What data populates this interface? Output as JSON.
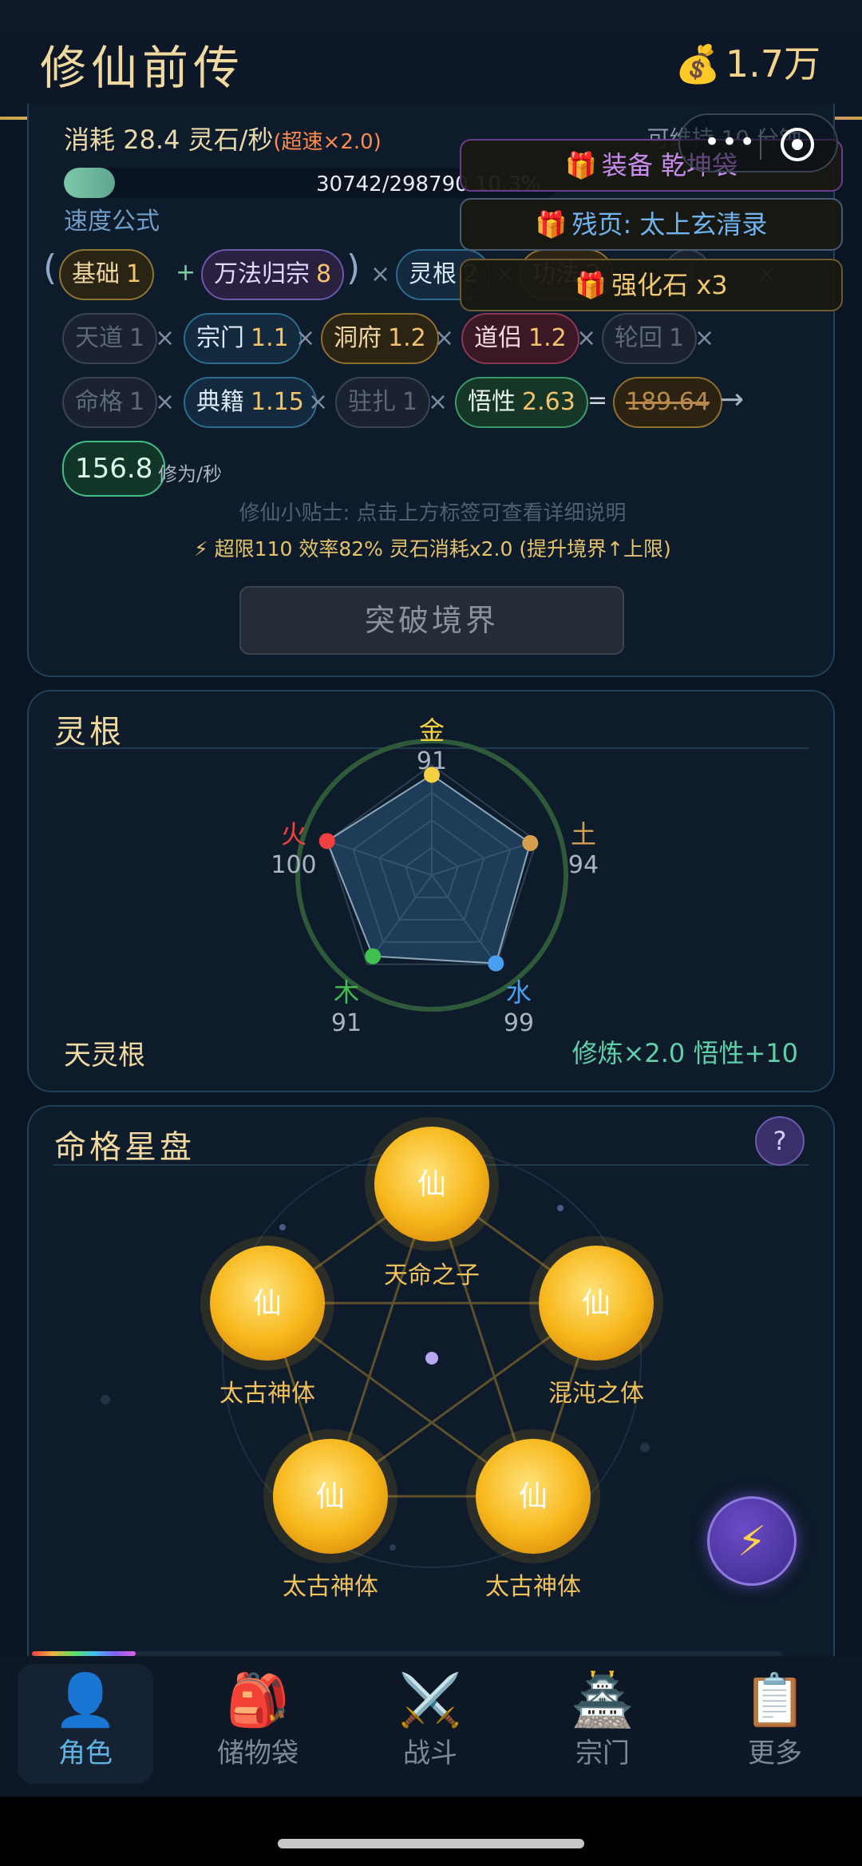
{
  "header": {
    "title": "修仙前传",
    "money_icon": "money-bag-icon",
    "money": "1.7万"
  },
  "speed": {
    "consume_prefix": "消耗",
    "consume_value": "28.4",
    "consume_unit": "灵石/秒",
    "boost": "(超速×2.0)",
    "sustain": "可维持 10 分钟",
    "progress_text": "30742/298790  10.3%",
    "progress_fraction": 0.103,
    "formula_label": "速度公式",
    "row1": {
      "open_paren": "(",
      "close_paren": ")",
      "plus": "+",
      "times": "×",
      "base": {
        "name": "基础",
        "value": "1"
      },
      "wanfa": {
        "name": "万法归宗",
        "value": "8"
      },
      "linggen": {
        "name": "灵根",
        "value": "2"
      },
      "gongfa": {
        "name": "功法",
        "value": "2"
      },
      "hidden": {
        "name": "",
        "value": "1"
      }
    },
    "row2": [
      {
        "name": "天道",
        "value": "1"
      },
      {
        "name": "宗门",
        "value": "1.1"
      },
      {
        "name": "洞府",
        "value": "1.2"
      },
      {
        "name": "道侣",
        "value": "1.2"
      },
      {
        "name": "轮回",
        "value": "1"
      }
    ],
    "row3": [
      {
        "name": "命格",
        "value": "1"
      },
      {
        "name": "典籍",
        "value": "1.15"
      },
      {
        "name": "驻扎",
        "value": "1"
      },
      {
        "name": "悟性",
        "value": "2.63"
      }
    ],
    "equals": "=",
    "struck": "189.64",
    "arrow": "→",
    "result": "156.8",
    "result_unit": "修为/秒",
    "tip": "修仙小贴士: 点击上方标签可查看详细说明",
    "limit": "⚡ 超限110 效率82% 灵石消耗x2.0 (提升境界↑上限)",
    "break_button": "突破境界"
  },
  "toasts": [
    {
      "text": "装备 乾坤袋",
      "icon": "gift-icon"
    },
    {
      "text": "残页: 太上玄清录",
      "icon": "gift-icon"
    },
    {
      "text": "强化石 x3",
      "icon": "gift-icon"
    }
  ],
  "root": {
    "title": "灵根",
    "elements": [
      {
        "name": "金",
        "value": "91",
        "color": "#f5d040"
      },
      {
        "name": "土",
        "value": "94",
        "color": "#d4a050"
      },
      {
        "name": "水",
        "value": "99",
        "color": "#4aa0f0"
      },
      {
        "name": "木",
        "value": "91",
        "color": "#40c050"
      },
      {
        "name": "火",
        "value": "100",
        "color": "#f04040"
      }
    ],
    "values_numeric": [
      91,
      94,
      99,
      91,
      100
    ],
    "type_name": "天灵根",
    "bonus": "修炼×2.0  悟性+10"
  },
  "star": {
    "title": "命格星盘",
    "help": "?",
    "orbs": [
      {
        "glyph": "仙",
        "label": "天命之子"
      },
      {
        "glyph": "仙",
        "label": "太古神体"
      },
      {
        "glyph": "仙",
        "label": "混沌之体"
      },
      {
        "glyph": "仙",
        "label": "太古神体"
      },
      {
        "glyph": "仙",
        "label": "太古神体"
      }
    ],
    "fab_icon": "⚡"
  },
  "nav": [
    {
      "label": "角色",
      "icon": "👤",
      "icon_name": "person-icon",
      "active": true
    },
    {
      "label": "储物袋",
      "icon": "🎒",
      "icon_name": "backpack-icon",
      "active": false
    },
    {
      "label": "战斗",
      "icon": "⚔️",
      "icon_name": "crossed-swords-icon",
      "active": false
    },
    {
      "label": "宗门",
      "icon": "🏯",
      "icon_name": "pagoda-icon",
      "active": false
    },
    {
      "label": "更多",
      "icon": "📋",
      "icon_name": "clipboard-icon",
      "active": false
    }
  ],
  "colors": {
    "gold": "#f0d9a0",
    "accent_green": "#5fd0a8",
    "panel_border": "#21415a"
  }
}
